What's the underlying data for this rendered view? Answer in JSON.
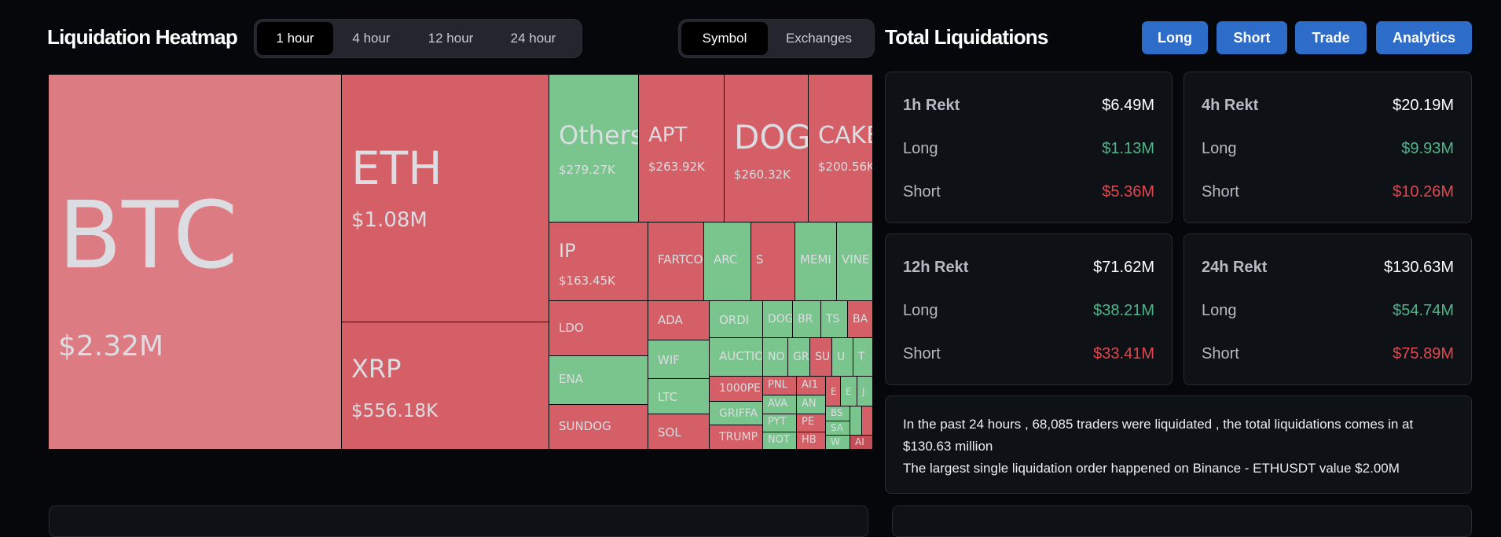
{
  "heatmap": {
    "title": "Liquidation Heatmap",
    "time_options": [
      "1 hour",
      "4 hour",
      "12 hour",
      "24 hour"
    ],
    "time_selected": "1 hour",
    "group_options": [
      "Symbol",
      "Exchanges"
    ],
    "group_selected": "Symbol",
    "cells": [
      {
        "symbol": "BTC",
        "value": "$2.32M",
        "color": "pink"
      },
      {
        "symbol": "ETH",
        "value": "$1.08M",
        "color": "red"
      },
      {
        "symbol": "XRP",
        "value": "$556.18K",
        "color": "red"
      },
      {
        "symbol": "Others",
        "value": "$279.27K",
        "color": "green"
      },
      {
        "symbol": "APT",
        "value": "$263.92K",
        "color": "red"
      },
      {
        "symbol": "DOGE",
        "value": "$260.32K",
        "color": "red"
      },
      {
        "symbol": "CAKE",
        "value": "$200.56K",
        "color": "red"
      },
      {
        "symbol": "IP",
        "value": "$163.45K",
        "color": "red"
      },
      {
        "symbol": "FARTCO",
        "value": "",
        "color": "red"
      },
      {
        "symbol": "ARC",
        "value": "",
        "color": "green"
      },
      {
        "symbol": "S",
        "value": "",
        "color": "red"
      },
      {
        "symbol": "MEMI",
        "value": "",
        "color": "green"
      },
      {
        "symbol": "VINE",
        "value": "",
        "color": "green"
      },
      {
        "symbol": "LDO",
        "value": "",
        "color": "red"
      },
      {
        "symbol": "ENA",
        "value": "",
        "color": "green"
      },
      {
        "symbol": "SUNDOG",
        "value": "",
        "color": "red"
      },
      {
        "symbol": "ADA",
        "value": "",
        "color": "red"
      },
      {
        "symbol": "WIF",
        "value": "",
        "color": "green"
      },
      {
        "symbol": "LTC",
        "value": "",
        "color": "green"
      },
      {
        "symbol": "SOL",
        "value": "",
        "color": "red"
      },
      {
        "symbol": "ORDI",
        "value": "",
        "color": "green"
      },
      {
        "symbol": "AUCTIO",
        "value": "",
        "color": "green"
      },
      {
        "symbol": "1000PE",
        "value": "",
        "color": "red"
      },
      {
        "symbol": "GRIFFA",
        "value": "",
        "color": "green"
      },
      {
        "symbol": "TRUMP",
        "value": "",
        "color": "red"
      },
      {
        "symbol": "DOG",
        "value": "",
        "color": "green"
      },
      {
        "symbol": "BR",
        "value": "",
        "color": "green"
      },
      {
        "symbol": "TS",
        "value": "",
        "color": "green"
      },
      {
        "symbol": "BA",
        "value": "",
        "color": "red"
      },
      {
        "symbol": "NO",
        "value": "",
        "color": "green"
      },
      {
        "symbol": "GR",
        "value": "",
        "color": "green"
      },
      {
        "symbol": "SU",
        "value": "",
        "color": "red"
      },
      {
        "symbol": "U",
        "value": "",
        "color": "green"
      },
      {
        "symbol": "T",
        "value": "",
        "color": "green"
      },
      {
        "symbol": "PNL",
        "value": "",
        "color": "red"
      },
      {
        "symbol": "AI1",
        "value": "",
        "color": "red"
      },
      {
        "symbol": "E",
        "value": "",
        "color": "red"
      },
      {
        "symbol": "E",
        "value": "",
        "color": "green"
      },
      {
        "symbol": "J",
        "value": "",
        "color": "green"
      },
      {
        "symbol": "AVA",
        "value": "",
        "color": "green"
      },
      {
        "symbol": "AN",
        "value": "",
        "color": "green"
      },
      {
        "symbol": "PYT",
        "value": "",
        "color": "green"
      },
      {
        "symbol": "PE",
        "value": "",
        "color": "red"
      },
      {
        "symbol": "NOT",
        "value": "",
        "color": "green"
      },
      {
        "symbol": "HB",
        "value": "",
        "color": "red"
      },
      {
        "symbol": "BS",
        "value": "",
        "color": "green"
      },
      {
        "symbol": "SA",
        "value": "",
        "color": "green"
      },
      {
        "symbol": "W",
        "value": "",
        "color": "green"
      },
      {
        "symbol": "",
        "value": "",
        "color": "green"
      },
      {
        "symbol": "",
        "value": "",
        "color": "red"
      },
      {
        "symbol": "AI",
        "value": "",
        "color": "dred"
      }
    ]
  },
  "total": {
    "title": "Total Liquidations",
    "buttons": [
      "Long",
      "Short",
      "Trade",
      "Analytics"
    ],
    "cards": [
      {
        "label": "1h Rekt",
        "total": "$6.49M",
        "long_label": "Long",
        "long": "$1.13M",
        "short_label": "Short",
        "short": "$5.36M"
      },
      {
        "label": "4h Rekt",
        "total": "$20.19M",
        "long_label": "Long",
        "long": "$9.93M",
        "short_label": "Short",
        "short": "$10.26M"
      },
      {
        "label": "12h Rekt",
        "total": "$71.62M",
        "long_label": "Long",
        "long": "$38.21M",
        "short_label": "Short",
        "short": "$33.41M"
      },
      {
        "label": "24h Rekt",
        "total": "$130.63M",
        "long_label": "Long",
        "long": "$54.74M",
        "short_label": "Short",
        "short": "$75.89M"
      }
    ],
    "summary_line1": "In the past 24 hours , 68,085 traders were liquidated , the total liquidations comes in at $130.63 million",
    "summary_line2": "The largest single liquidation order happened on Binance - ETHUSDT value $2.00M"
  },
  "colors": {
    "long": "#4fb48a",
    "short": "#e2484f",
    "cell_red": "#d55f66",
    "cell_green": "#79c58d",
    "cell_pink": "#dc7c82",
    "button_blue": "#2e6cc9"
  }
}
